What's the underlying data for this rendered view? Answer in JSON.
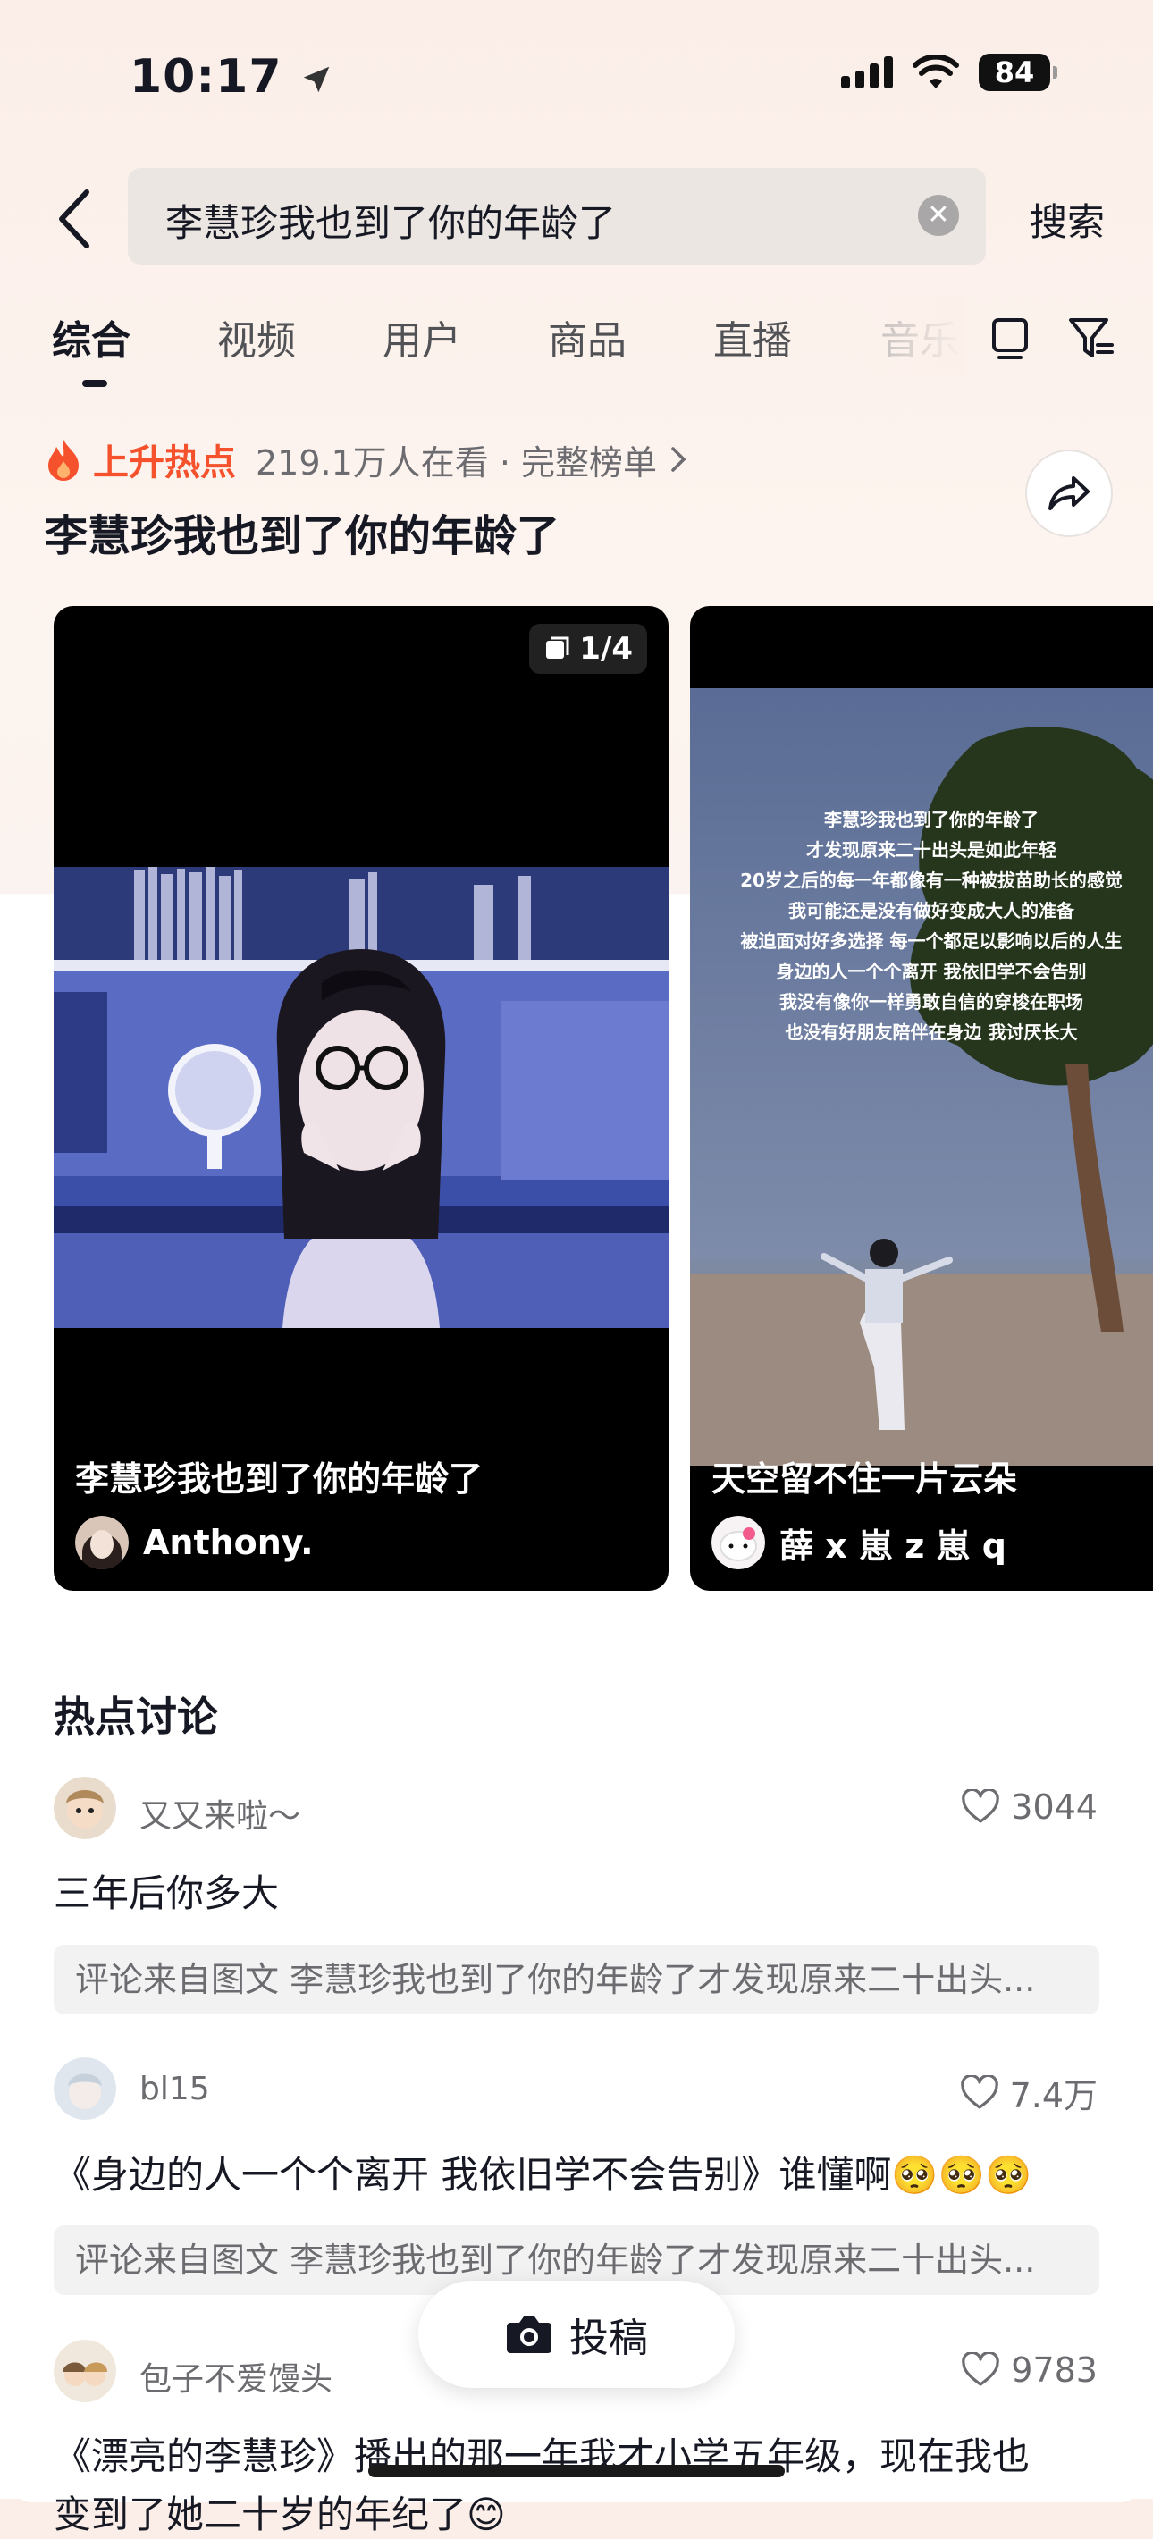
{
  "status_bar": {
    "time": "10:17",
    "battery": "84"
  },
  "search": {
    "query": "李慧珍我也到了你的年龄了",
    "button": "搜索"
  },
  "tabs": [
    "综合",
    "视频",
    "用户",
    "商品",
    "直播",
    "音乐"
  ],
  "hot": {
    "label": "上升热点",
    "meta": "219.1万人在看 · 完整榜单",
    "title": "李慧珍我也到了你的年龄了"
  },
  "cards": [
    {
      "badge": "1/4",
      "caption": "李慧珍我也到了你的年龄了",
      "author": "Anthony."
    },
    {
      "overlay_lines": [
        "李慧珍我也到了你的年龄了",
        "才发现原来二十出头是如此年轻",
        "20岁之后的每一年都像有一种被拔苗助长的感觉",
        "我可能还是没有做好变成大人的准备",
        "被迫面对好多选择 每一个都足以影响以后的人生",
        "身边的人一个个离开 我依旧学不会告别",
        "我没有像你一样勇敢自信的穿梭在职场",
        "也没有好朋友陪伴在身边 我讨厌长大"
      ],
      "caption": "天空留不住一片云朵",
      "author": "薛 x 崽 z 崽 q"
    }
  ],
  "discussion": {
    "title": "热点讨论",
    "items": [
      {
        "name": "又又来啦～",
        "likes": "3044",
        "text": "三年后你多大",
        "source": "评论来自图文  李慧珍我也到了你的年龄了才发现原来二十出头..."
      },
      {
        "name": "bl15",
        "likes": "7.4万",
        "text": "《身边的人一个个离开 我依旧学不会告别》谁懂啊🥺🥺🥺",
        "source": "评论来自图文  李慧珍我也到了你的年龄了才发现原来二十出头..."
      },
      {
        "name": "包子不爱馒头",
        "likes": "9783",
        "text": "《漂亮的李慧珍》播出的那一年我才小学五年级，现在我也",
        "text2": "变到了她二十岁的年纪了😊"
      }
    ]
  },
  "post_button": "投稿"
}
